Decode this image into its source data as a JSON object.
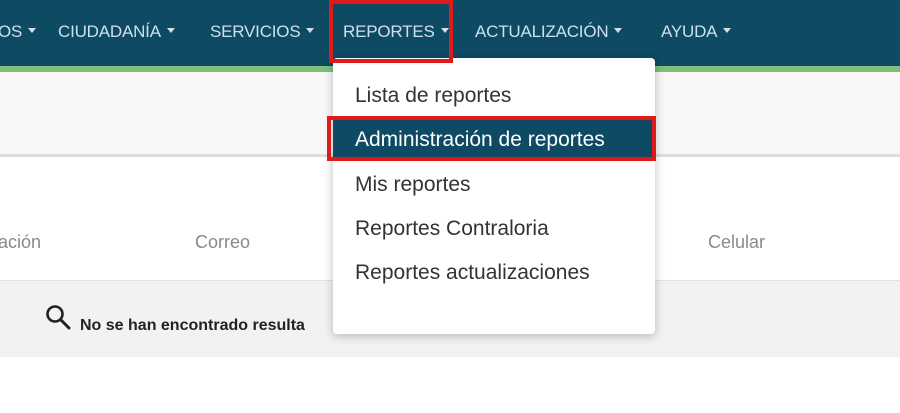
{
  "nav": {
    "items": [
      {
        "label": "OS"
      },
      {
        "label": "CIUDADANÍA"
      },
      {
        "label": "SERVICIOS"
      },
      {
        "label": "REPORTES"
      },
      {
        "label": "ACTUALIZACIÓN"
      },
      {
        "label": "AYUDA"
      }
    ]
  },
  "dropdown": {
    "items": [
      {
        "label": "Lista de reportes"
      },
      {
        "label": "Administración de reportes"
      },
      {
        "label": "Mis reportes"
      },
      {
        "label": "Reportes Contraloria"
      },
      {
        "label": "Reportes actualizaciones"
      }
    ]
  },
  "table": {
    "headers": [
      "ación",
      "Correo",
      "Celular"
    ],
    "empty_message": "No se han encontrado resulta"
  },
  "colors": {
    "nav_bg": "#0e4a63",
    "highlight": "#e01a1a",
    "active_item_bg": "#0e4a63"
  }
}
